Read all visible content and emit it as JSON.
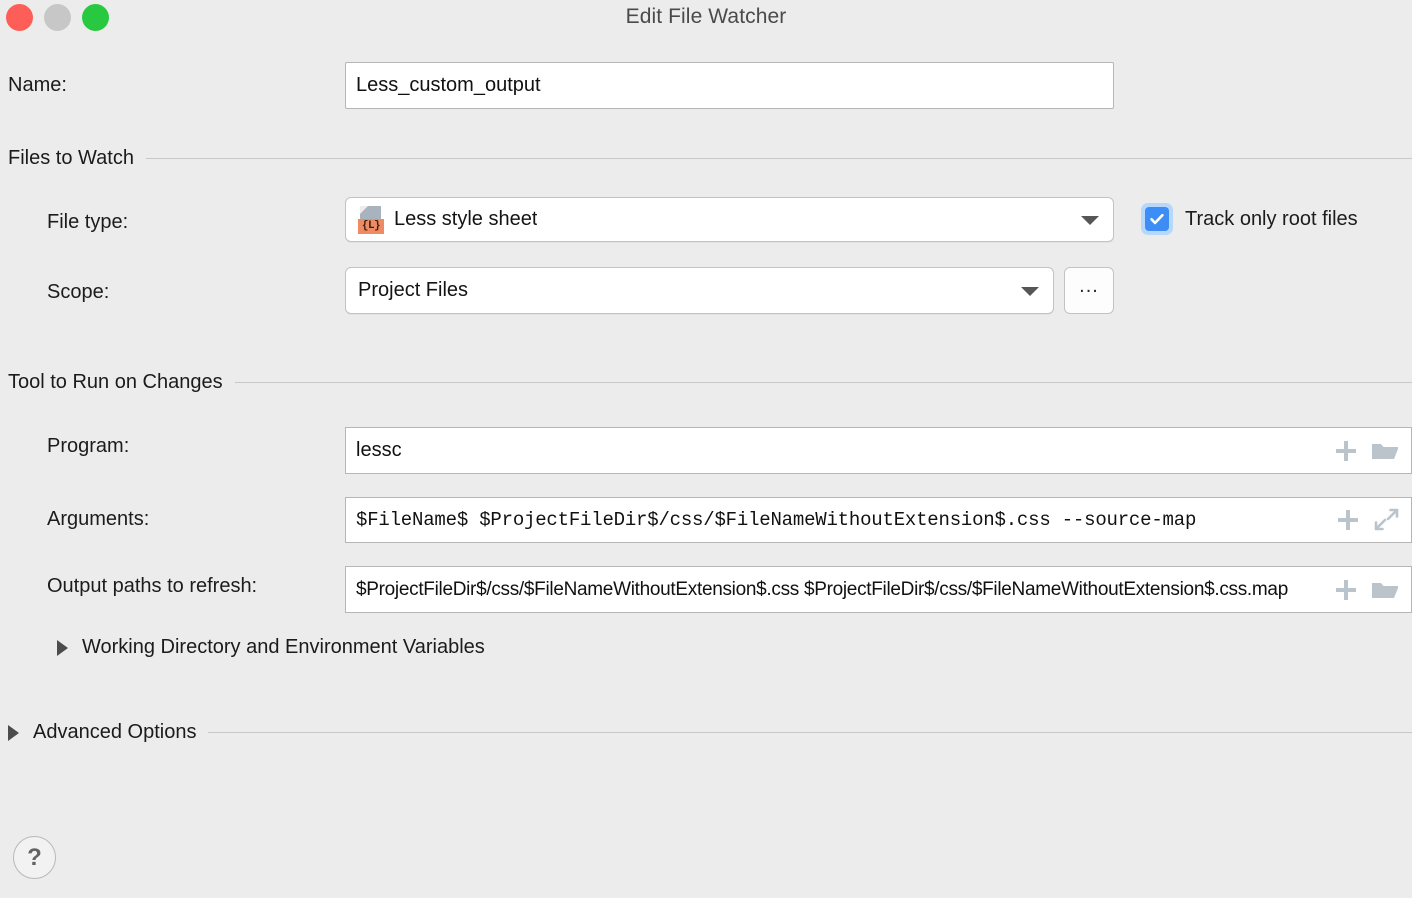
{
  "window": {
    "title": "Edit File Watcher",
    "controls": {
      "close": "close-button",
      "minimize": "minimize-button",
      "zoom": "zoom-button"
    }
  },
  "name_row": {
    "label": "Name:",
    "value": "Less_custom_output",
    "placeholder": ""
  },
  "files_to_watch": {
    "section_title": "Files to Watch",
    "file_type": {
      "label": "File type:",
      "value": "Less style sheet",
      "icon": "less-file-icon",
      "icon_badge": "{L}"
    },
    "scope": {
      "label": "Scope:",
      "value": "Project Files",
      "browse_label": "..."
    },
    "track_only_root": {
      "label": "Track only root files",
      "checked": true
    }
  },
  "tool_to_run": {
    "section_title": "Tool to Run on Changes",
    "program": {
      "label": "Program:",
      "value": "lessc",
      "icons": [
        "insert-macro-icon",
        "browse-folder-icon"
      ]
    },
    "arguments": {
      "label": "Arguments:",
      "value": "$FileName$ $ProjectFileDir$/css/$FileNameWithoutExtension$.css --source-map",
      "icons": [
        "insert-macro-icon",
        "expand-editor-icon"
      ]
    },
    "output_paths": {
      "label": "Output paths to refresh:",
      "value": "$ProjectFileDir$/css/$FileNameWithoutExtension$.css $ProjectFileDir$/css/$FileNameWithoutExtension$.css.map",
      "icons": [
        "insert-macro-icon",
        "browse-folder-icon"
      ]
    },
    "working_directory": {
      "label": "Working Directory and Environment Variables",
      "expanded": false
    }
  },
  "advanced_options": {
    "section_title": "Advanced Options",
    "expanded": false
  },
  "help": {
    "label": "?"
  },
  "colors": {
    "window_background": "#ececec",
    "accent_checkbox": "#3c8df5",
    "checkbox_focus_ring": "#b8d8fb",
    "icon_grey": "#bcc4cb",
    "less_badge_orange": "#ef8b62",
    "less_page_grey": "#a9b3bd",
    "close_red": "#fd5e57",
    "minimize_grey": "#c7c7c7",
    "zoom_green": "#28c840"
  }
}
